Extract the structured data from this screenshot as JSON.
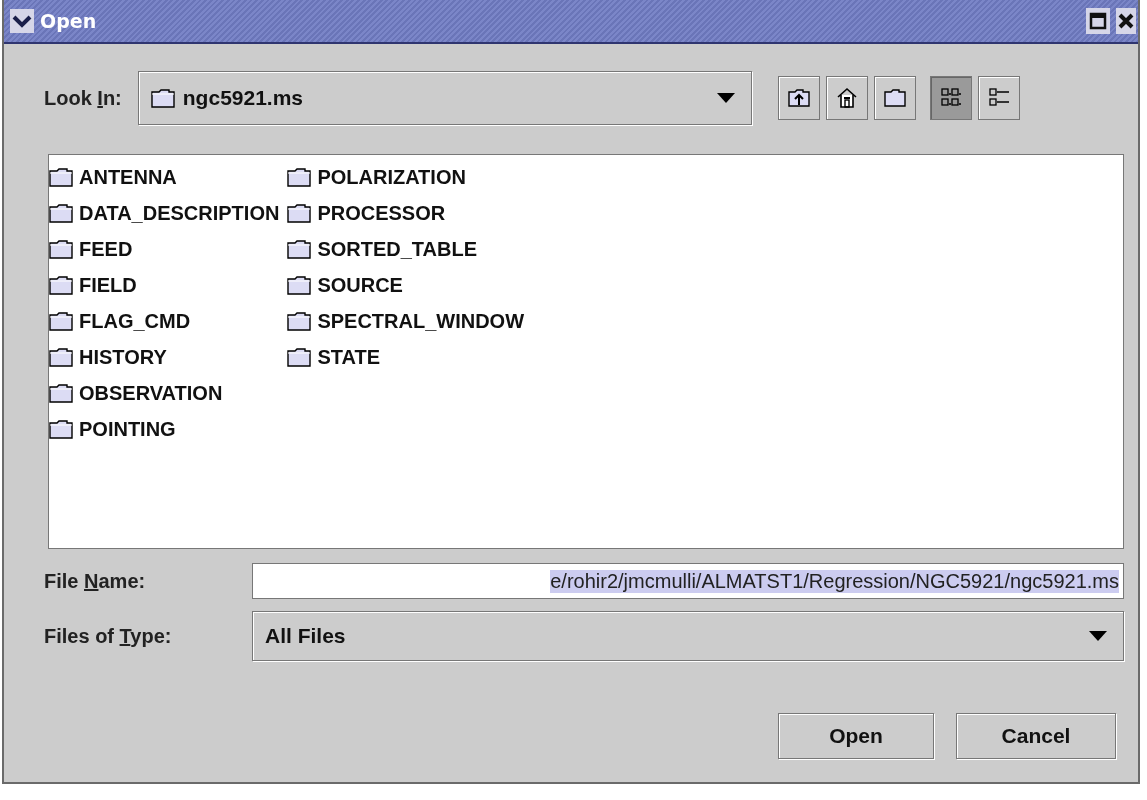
{
  "window": {
    "title": "Open"
  },
  "look_in": {
    "label_parts": [
      "Look ",
      "I",
      "n:"
    ],
    "value": "ngc5921.ms"
  },
  "toolbar": [
    {
      "kind": "up",
      "selected": false
    },
    {
      "kind": "home",
      "selected": false
    },
    {
      "kind": "newfolder",
      "selected": false
    },
    {
      "kind": "list",
      "selected": true
    },
    {
      "kind": "details",
      "selected": false
    }
  ],
  "files": [
    {
      "name": "ANTENNA"
    },
    {
      "name": "DATA_DESCRIPTION"
    },
    {
      "name": "FEED"
    },
    {
      "name": "FIELD"
    },
    {
      "name": "FLAG_CMD"
    },
    {
      "name": "HISTORY"
    },
    {
      "name": "OBSERVATION"
    },
    {
      "name": "POINTING"
    },
    {
      "name": "POLARIZATION"
    },
    {
      "name": "PROCESSOR"
    },
    {
      "name": "SORTED_TABLE"
    },
    {
      "name": "SOURCE"
    },
    {
      "name": "SPECTRAL_WINDOW"
    },
    {
      "name": "STATE"
    }
  ],
  "file_name": {
    "label_parts": [
      "File ",
      "N",
      "ame:"
    ],
    "value": "e/rohir2/jmcmulli/ALMATST1/Regression/NGC5921/ngc5921.ms",
    "selected": true
  },
  "files_of_type": {
    "label_parts": [
      "Files of ",
      "T",
      "ype:"
    ],
    "value": "All Files"
  },
  "buttons": [
    "Open",
    "Cancel"
  ]
}
